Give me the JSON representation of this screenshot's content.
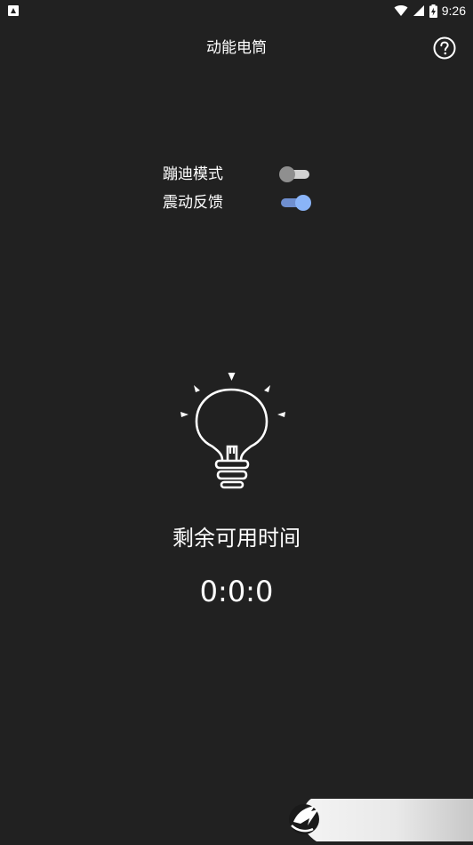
{
  "status_bar": {
    "time": "9:26",
    "icons": [
      "app-notification-icon",
      "wifi-icon",
      "signal-icon",
      "battery-charging-icon"
    ]
  },
  "header": {
    "title": "动能电筒",
    "help_icon": "help-circle-icon"
  },
  "settings": {
    "disco_mode": {
      "label": "蹦迪模式",
      "enabled": false
    },
    "vibration_feedback": {
      "label": "震动反馈",
      "enabled": true
    }
  },
  "main": {
    "bulb_icon": "lightbulb-icon",
    "remaining_label": "剩余可用时间",
    "remaining_value": "0:0:0"
  },
  "colors": {
    "background": "#212121",
    "text": "#ffffff",
    "switch_on_thumb": "#8ab4f8",
    "switch_on_track": "#6f8fd0",
    "switch_off_thumb": "#8f8f8f",
    "switch_off_track": "#d2d2d2"
  },
  "watermark": {
    "icon": "logo-watermark-icon"
  }
}
